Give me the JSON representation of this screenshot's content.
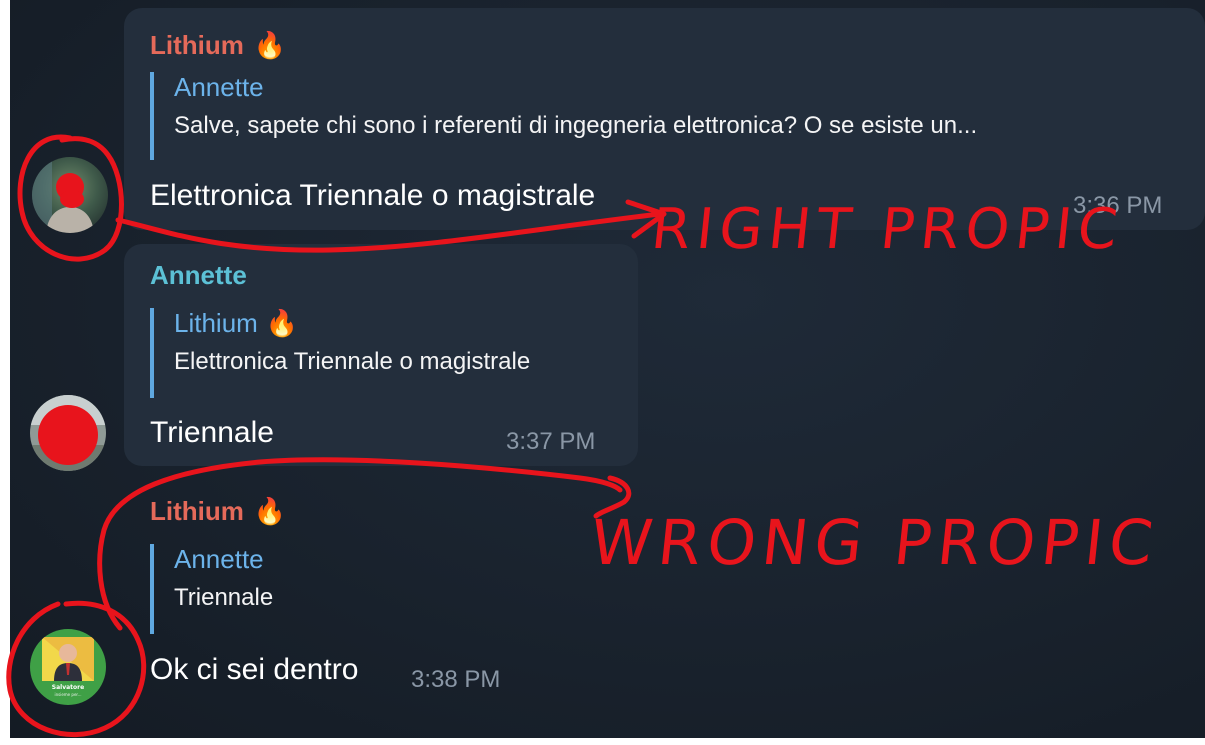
{
  "messages": [
    {
      "sender": "Lithium",
      "sender_emoji": "🔥",
      "quote_sender": "Annette",
      "quote_sender_emoji": "",
      "quote_text": "Salve, sapete chi sono i referenti di ingegneria elettronica? O se esiste un...",
      "text": "Elettronica Triennale o magistrale",
      "time": "3:36 PM"
    },
    {
      "sender": "Annette",
      "sender_emoji": "",
      "quote_sender": "Lithium",
      "quote_sender_emoji": "🔥",
      "quote_text": "Elettronica Triennale o magistrale",
      "text": "Triennale",
      "time": "3:37 PM"
    },
    {
      "sender": "Lithium",
      "sender_emoji": "🔥",
      "quote_sender": "Annette",
      "quote_sender_emoji": "",
      "quote_text": "Triennale",
      "text": "Ok ci sei dentro",
      "time": "3:38 PM"
    }
  ],
  "avatar_badge": {
    "line1": "Salvatore",
    "line2": "insieme per..."
  },
  "annotations": {
    "right_label": "RIGHT PROPIC",
    "wrong_label": "WRONG PROPIC"
  },
  "colors": {
    "chat_background": "#19222d",
    "bubble": "#232e3c",
    "lithium_name": "#e56a5a",
    "annette_name": "#5cc1d6",
    "quote_name": "#6cb3ea",
    "annotation_red": "#e8141c"
  }
}
